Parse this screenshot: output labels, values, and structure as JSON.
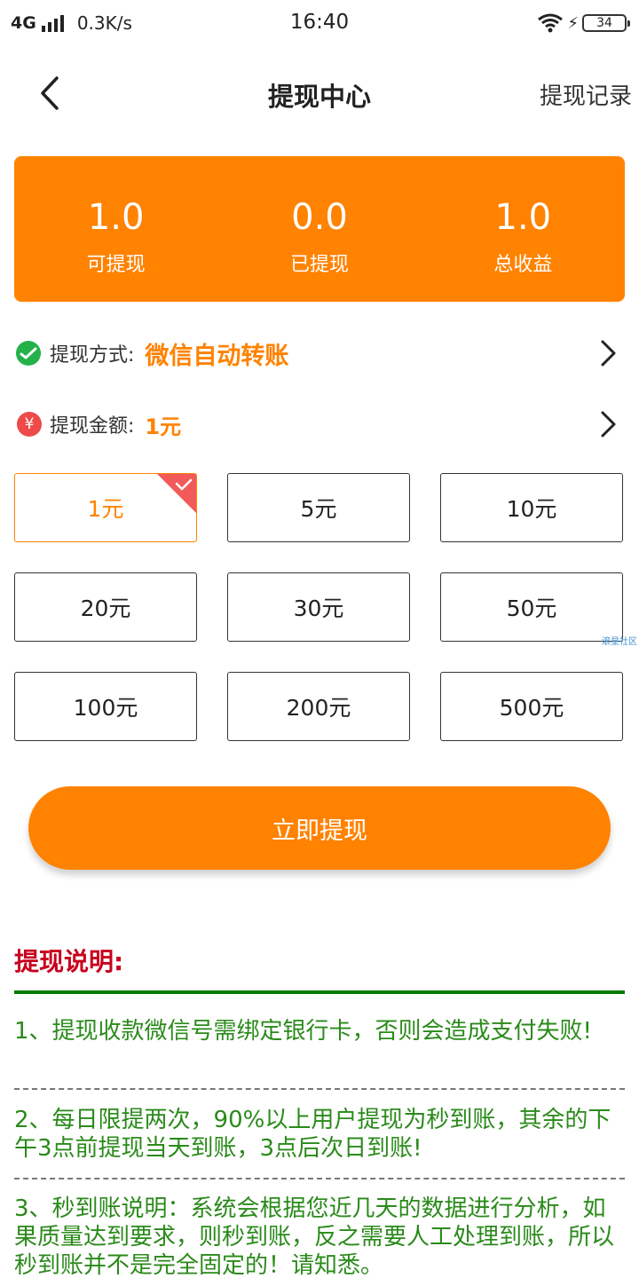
{
  "status_bar": {
    "network": "4G",
    "speed": "0.3K/s",
    "time": "16:40",
    "battery": "34"
  },
  "nav": {
    "title": "提现中心",
    "right_link": "提现记录"
  },
  "summary": [
    {
      "value": "1.0",
      "label": "可提现"
    },
    {
      "value": "0.0",
      "label": "已提现"
    },
    {
      "value": "1.0",
      "label": "总收益"
    }
  ],
  "method": {
    "label": "提现方式:",
    "value": "微信自动转账",
    "icon": "wechat-pay-icon"
  },
  "amount_row": {
    "label": "提现金额:",
    "value": "1元",
    "icon_glyph": "¥"
  },
  "amounts": [
    {
      "label": "1元",
      "selected": true
    },
    {
      "label": "5元",
      "selected": false
    },
    {
      "label": "10元",
      "selected": false
    },
    {
      "label": "20元",
      "selected": false
    },
    {
      "label": "30元",
      "selected": false
    },
    {
      "label": "50元",
      "selected": false
    },
    {
      "label": "100元",
      "selected": false
    },
    {
      "label": "200元",
      "selected": false
    },
    {
      "label": "500元",
      "selected": false
    }
  ],
  "watermark": "滚星社区",
  "withdraw_button": "立即提现",
  "notes": {
    "title": "提现说明:",
    "items": [
      "1、提现收款微信号需绑定银行卡，否则会造成支付失败!",
      "2、每日限提两次，90%以上用户提现为秒到账，其余的下午3点前提现当天到账，3点后次日到账!",
      "3、秒到账说明：系统会根据您近几天的数据进行分析，如果质量达到要求，则秒到账，反之需要人工处理到账，所以秒到账并不是完全固定的！请知悉。"
    ]
  },
  "colors": {
    "accent": "#ff8200",
    "notes_title": "#c8001e",
    "notes_text": "#2a8a1a",
    "notes_rule": "#007a00"
  }
}
